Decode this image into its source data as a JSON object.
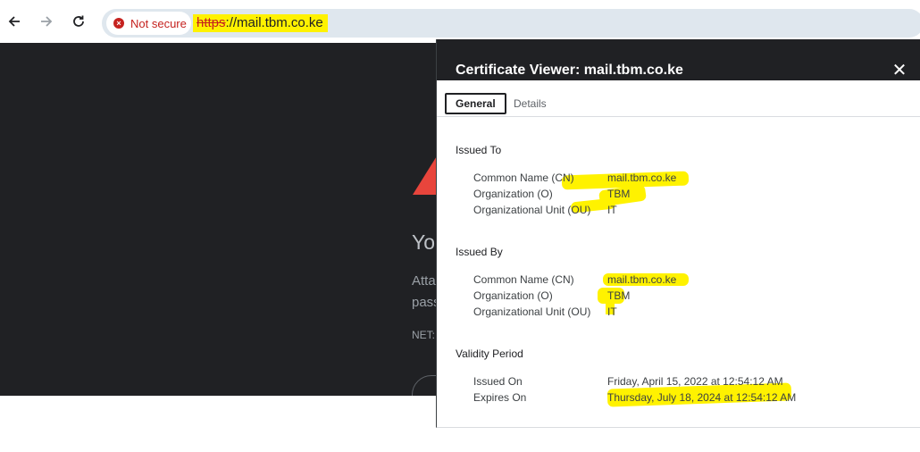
{
  "browser": {
    "security_chip_text": "Not secure",
    "url_scheme": "https",
    "url_rest": "://mail.tbm.co.ke"
  },
  "page": {
    "heading_fragment": "Yo",
    "line1_fragment": "Atta",
    "line2_fragment": "pass",
    "code_fragment": "NET::"
  },
  "dialog": {
    "title": "Certificate Viewer: mail.tbm.co.ke",
    "tabs": [
      {
        "label": "General",
        "selected": true
      },
      {
        "label": "Details",
        "selected": false
      }
    ],
    "issued_to": {
      "title": "Issued To",
      "fields": [
        {
          "label": "Common Name (CN)",
          "value": "mail.tbm.co.ke"
        },
        {
          "label": "Organization (O)",
          "value": "TBM"
        },
        {
          "label": "Organizational Unit (OU)",
          "value": "IT"
        }
      ]
    },
    "issued_by": {
      "title": "Issued By",
      "fields": [
        {
          "label": "Common Name (CN)",
          "value": "mail.tbm.co.ke"
        },
        {
          "label": "Organization (O)",
          "value": "TBM"
        },
        {
          "label": "Organizational Unit (OU)",
          "value": "IT"
        }
      ]
    },
    "validity": {
      "title": "Validity Period",
      "fields": [
        {
          "label": "Issued On",
          "value": "Friday, April 15, 2022 at 12:54:12 AM"
        },
        {
          "label": "Expires On",
          "value": "Thursday, July 18, 2024 at 12:54:12 AM"
        }
      ]
    }
  },
  "colors": {
    "highlight": "#fff200",
    "danger": "#c5221f",
    "dark_background": "#202124",
    "warning_triangle": "#e8453c"
  }
}
